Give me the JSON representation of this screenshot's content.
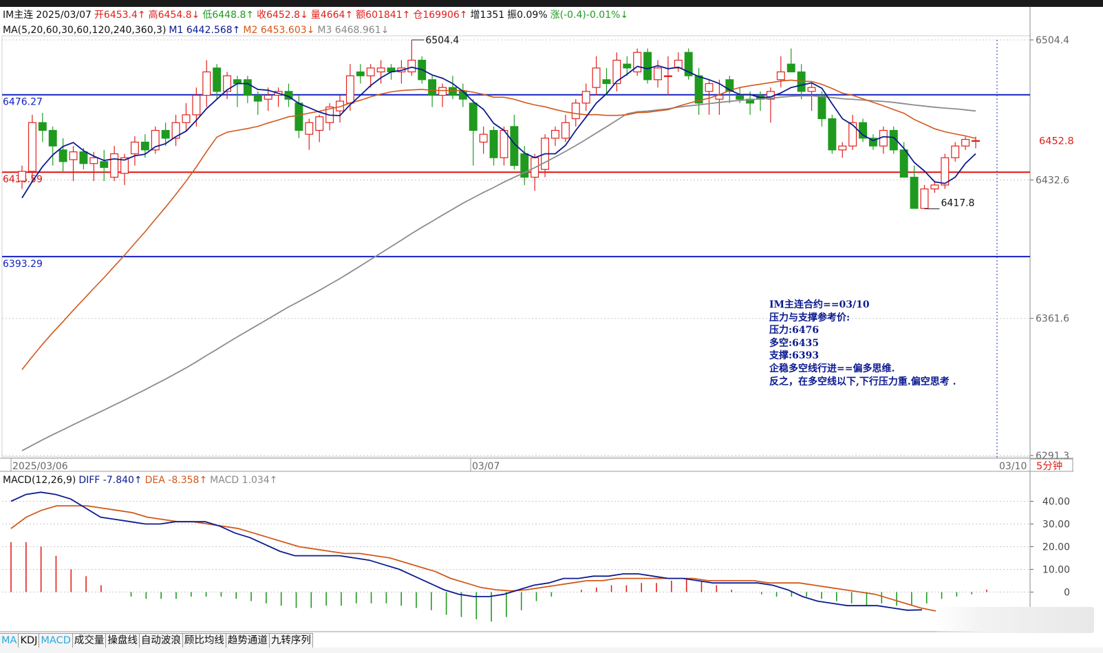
{
  "header": {
    "symbol": "IM主连",
    "date": "2025/03/07",
    "open": "开6453.4↑",
    "high": "高6454.8↓",
    "low": "低6448.8↑",
    "close": "收6452.8↓",
    "volume": "量4664↑",
    "amount": "额601841↑",
    "position": "仓169906↑",
    "increase": "增1351",
    "amplitude": "振0.09%",
    "change": "涨(-0.4)-0.01%↓"
  },
  "ma_header": {
    "params": "MA(5,20,60,30,60,120,240,360,3)",
    "m1": "M1 6442.568↑",
    "m2": "M2 6453.603↓",
    "m3": "M3 6468.961↓"
  },
  "price_axis": {
    "ticks": [
      "6504.4",
      "6432.6",
      "6361.6",
      "6291.3"
    ],
    "current_price": "6452.8"
  },
  "levels": {
    "pressure": {
      "label": "6476.27",
      "value": 6476.27,
      "color": "#1020c0"
    },
    "pivot": {
      "label": "6436.59",
      "value": 6436.59,
      "color": "#e01010"
    },
    "support": {
      "label": "6393.29",
      "value": 6393.29,
      "color": "#1020c0"
    }
  },
  "annotations": {
    "high_mark": "6504.4",
    "low_mark": "6417.8"
  },
  "date_axis": {
    "labels": [
      "2025/03/06",
      "03/07",
      "03/10"
    ],
    "period": "5分钟"
  },
  "note": {
    "lines": [
      "IM主连合约==03/10",
      "压力与支撑参考价:",
      "压力:6476",
      "多空:6435",
      "支撑:6393",
      "企稳多空线行进==偏多思维.",
      "反之，在多空线以下,下行压力重.偏空思考 ."
    ]
  },
  "macd_header": {
    "params": "MACD(12,26,9)",
    "diff": "DIFF -7.840↑",
    "dea": "DEA -8.358↑",
    "macd": "MACD 1.034↑"
  },
  "macd_axis": {
    "ticks": [
      "40.00",
      "30.00",
      "20.00",
      "10.00",
      "0"
    ]
  },
  "tabs": [
    "MA",
    "KDJ",
    "MACD",
    "成交量",
    "操盘线",
    "自动波浪",
    "顾比均线",
    "趋势通道",
    "九转序列"
  ],
  "colors": {
    "up": "#e0201c",
    "down": "#1f9a1f",
    "ma1": "#0b1a8f",
    "ma2": "#d2581a",
    "ma3": "#8c8c8c"
  },
  "chart_data": {
    "type": "candlestick",
    "symbol": "IM主连",
    "period": "5分钟",
    "price_ylim": [
      6291.3,
      6504.4
    ],
    "levels": [
      6476.27,
      6436.59,
      6393.29
    ],
    "candles": [
      [
        6432,
        6440,
        6428,
        6437
      ],
      [
        6437,
        6466,
        6432,
        6462
      ],
      [
        6462,
        6467,
        6452,
        6458
      ],
      [
        6458,
        6460,
        6440,
        6450
      ],
      [
        6448,
        6454,
        6437,
        6442
      ],
      [
        6443,
        6450,
        6432,
        6447
      ],
      [
        6447,
        6449,
        6438,
        6441
      ],
      [
        6441,
        6447,
        6432,
        6444
      ],
      [
        6442,
        6448,
        6432,
        6439
      ],
      [
        6434,
        6450,
        6432,
        6446
      ],
      [
        6436,
        6446,
        6430,
        6444
      ],
      [
        6446,
        6455,
        6440,
        6452
      ],
      [
        6452,
        6456,
        6444,
        6448
      ],
      [
        6448,
        6460,
        6446,
        6458
      ],
      [
        6458,
        6462,
        6450,
        6454
      ],
      [
        6454,
        6466,
        6450,
        6462
      ],
      [
        6462,
        6472,
        6458,
        6466
      ],
      [
        6466,
        6480,
        6460,
        6476
      ],
      [
        6476,
        6494,
        6470,
        6488
      ],
      [
        6490,
        6492,
        6474,
        6478
      ],
      [
        6478,
        6488,
        6474,
        6486
      ],
      [
        6484,
        6486,
        6470,
        6482
      ],
      [
        6484,
        6486,
        6472,
        6476
      ],
      [
        6476,
        6478,
        6466,
        6473
      ],
      [
        6474,
        6480,
        6468,
        6476
      ],
      [
        6476,
        6480,
        6470,
        6478
      ],
      [
        6478,
        6482,
        6470,
        6474
      ],
      [
        6472,
        6476,
        6454,
        6458
      ],
      [
        6456,
        6464,
        6448,
        6462
      ],
      [
        6458,
        6466,
        6452,
        6465
      ],
      [
        6462,
        6472,
        6458,
        6470
      ],
      [
        6468,
        6476,
        6462,
        6473
      ],
      [
        6472,
        6492,
        6468,
        6486
      ],
      [
        6488,
        6492,
        6482,
        6486
      ],
      [
        6486,
        6492,
        6480,
        6490
      ],
      [
        6488,
        6494,
        6482,
        6490
      ],
      [
        6490,
        6492,
        6484,
        6488
      ],
      [
        6488,
        6494,
        6482,
        6490
      ],
      [
        6488,
        6504.4,
        6486,
        6494
      ],
      [
        6494,
        6496,
        6482,
        6484
      ],
      [
        6484,
        6486,
        6470,
        6476
      ],
      [
        6476,
        6482,
        6470,
        6480
      ],
      [
        6480,
        6486,
        6474,
        6476
      ],
      [
        6478,
        6482,
        6470,
        6474
      ],
      [
        6472,
        6474,
        6440,
        6458
      ],
      [
        6452,
        6460,
        6446,
        6456
      ],
      [
        6458,
        6460,
        6440,
        6444
      ],
      [
        6444,
        6460,
        6440,
        6458
      ],
      [
        6460,
        6466,
        6438,
        6440
      ],
      [
        6446,
        6450,
        6430,
        6434
      ],
      [
        6434,
        6446,
        6427,
        6444
      ],
      [
        6438,
        6456,
        6434,
        6454
      ],
      [
        6454,
        6460,
        6450,
        6458
      ],
      [
        6454,
        6466,
        6452,
        6462
      ],
      [
        6464,
        6474,
        6460,
        6472
      ],
      [
        6472,
        6482,
        6468,
        6478
      ],
      [
        6480,
        6496,
        6476,
        6490
      ],
      [
        6484,
        6490,
        6476,
        6482
      ],
      [
        6482,
        6498,
        6478,
        6494
      ],
      [
        6492,
        6496,
        6486,
        6490
      ],
      [
        6488,
        6500,
        6486,
        6498
      ],
      [
        6498,
        6500,
        6482,
        6484
      ],
      [
        6484,
        6494,
        6480,
        6490
      ],
      [
        6486,
        6496,
        6476,
        6486
      ],
      [
        6490,
        6498,
        6488,
        6494
      ],
      [
        6498,
        6500,
        6484,
        6486
      ],
      [
        6486,
        6490,
        6466,
        6472
      ],
      [
        6478,
        6484,
        6466,
        6482
      ],
      [
        6474,
        6484,
        6466,
        6476
      ],
      [
        6484,
        6486,
        6472,
        6478
      ],
      [
        6476,
        6480,
        6472,
        6474
      ],
      [
        6474,
        6478,
        6466,
        6472
      ],
      [
        6476,
        6478,
        6468,
        6474
      ],
      [
        6474,
        6480,
        6462,
        6478
      ],
      [
        6484,
        6496,
        6480,
        6488
      ],
      [
        6492,
        6500,
        6488,
        6488
      ],
      [
        6488,
        6492,
        6474,
        6478
      ],
      [
        6478,
        6482,
        6468,
        6480
      ],
      [
        6476,
        6478,
        6460,
        6464
      ],
      [
        6464,
        6466,
        6446,
        6448
      ],
      [
        6448,
        6452,
        6444,
        6450
      ],
      [
        6450,
        6466,
        6448,
        6462
      ],
      [
        6462,
        6464,
        6452,
        6454
      ],
      [
        6454,
        6456,
        6448,
        6450
      ],
      [
        6450,
        6460,
        6446,
        6458
      ],
      [
        6458,
        6460,
        6446,
        6448
      ],
      [
        6448,
        6452,
        6434,
        6434
      ],
      [
        6434,
        6440,
        6418,
        6418
      ],
      [
        6418,
        6430,
        6417.8,
        6428
      ],
      [
        6428,
        6432,
        6426,
        6430
      ],
      [
        6430,
        6446,
        6428,
        6444
      ],
      [
        6444,
        6452,
        6442,
        6450
      ],
      [
        6450,
        6454.8,
        6448,
        6453.4
      ],
      [
        6452.8,
        6454.8,
        6448.8,
        6452.8
      ]
    ],
    "macd": {
      "params": "MACD(12,26,9)",
      "ylim": [
        -12,
        45
      ],
      "diff_last": -7.84,
      "dea_last": -8.358,
      "macd_last": 1.034,
      "diff": [
        40,
        43,
        44,
        43,
        41,
        37,
        33,
        32,
        31,
        30,
        30,
        31,
        31,
        31,
        29,
        26,
        24,
        21,
        18,
        16,
        16,
        16,
        16,
        15,
        14,
        12,
        10,
        7,
        4,
        1,
        -1,
        -2,
        -2,
        -1,
        1,
        3,
        4,
        6,
        6,
        7,
        7,
        8,
        8,
        7,
        6,
        6,
        5,
        4,
        4,
        4,
        4,
        3,
        1,
        -2,
        -4,
        -5,
        -6,
        -6,
        -6,
        -7,
        -8,
        -7.84
      ],
      "dea": [
        28,
        33,
        36,
        38,
        38,
        38,
        37,
        36,
        35,
        33,
        32,
        31,
        31,
        30,
        29,
        28,
        26,
        24,
        22,
        20,
        19,
        18,
        17,
        17,
        16,
        15,
        13,
        11,
        9,
        6,
        4,
        2,
        1,
        0.5,
        1,
        2,
        3,
        4,
        5,
        5,
        6,
        6,
        6,
        6,
        6,
        6,
        5,
        5,
        5,
        5,
        4,
        4,
        4,
        3,
        2,
        1,
        0,
        -1,
        -3,
        -5,
        -7,
        -8.358
      ],
      "hist": [
        22,
        22,
        20,
        16,
        10,
        7,
        3,
        0,
        -2,
        -3,
        -3,
        -3,
        -2,
        -2,
        -2,
        -3,
        -4,
        -5,
        -6,
        -7,
        -7,
        -6,
        -6,
        -5,
        -5,
        -5,
        -6,
        -7,
        -8,
        -10,
        -11,
        -12,
        -13,
        -11,
        -8,
        -4,
        -2,
        0,
        1,
        2,
        3,
        3,
        4,
        4,
        5,
        6,
        5,
        3,
        1,
        0,
        -1,
        -2,
        -2,
        -2,
        -3,
        -4,
        -5,
        -6,
        -5,
        -6,
        -6,
        -5,
        -3,
        -2,
        -1,
        1.034
      ]
    }
  }
}
